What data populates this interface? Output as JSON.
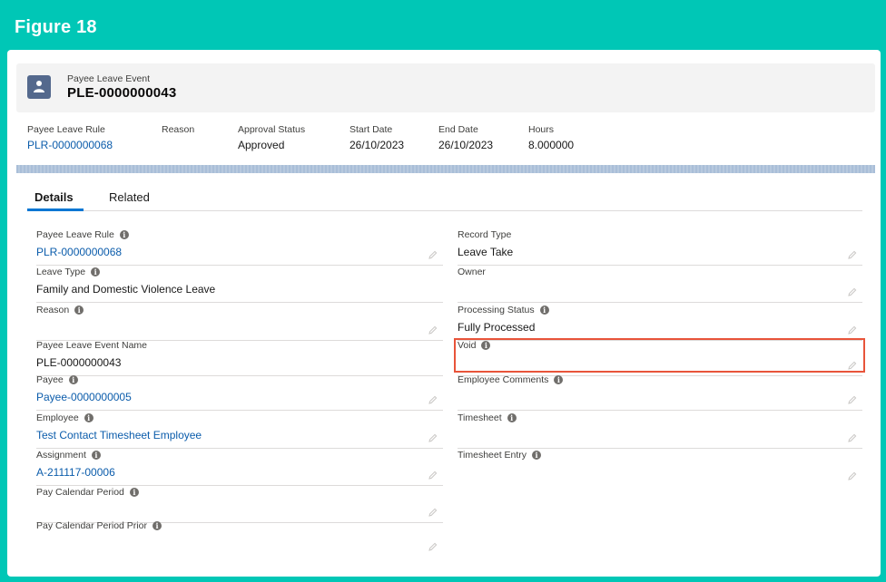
{
  "figure_title": "Figure 18",
  "record": {
    "object_type": "Payee Leave Event",
    "name": "PLE-0000000043"
  },
  "highlights": [
    {
      "label": "Payee Leave Rule",
      "value": "PLR-0000000068",
      "link": true
    },
    {
      "label": "Reason",
      "value": "",
      "link": false
    },
    {
      "label": "Approval Status",
      "value": "Approved",
      "link": false
    },
    {
      "label": "Start Date",
      "value": "26/10/2023",
      "link": false
    },
    {
      "label": "End Date",
      "value": "26/10/2023",
      "link": false
    },
    {
      "label": "Hours",
      "value": "8.000000",
      "link": false
    }
  ],
  "tabs": [
    {
      "label": "Details",
      "active": true
    },
    {
      "label": "Related",
      "active": false
    }
  ],
  "left_fields": [
    {
      "label": "Payee Leave Rule",
      "value": "PLR-0000000068",
      "link": true,
      "info": true,
      "editable": true
    },
    {
      "label": "Leave Type",
      "value": "Family and Domestic Violence Leave",
      "link": false,
      "info": true,
      "editable": false
    },
    {
      "label": "Reason",
      "value": "",
      "link": false,
      "info": true,
      "editable": true
    },
    {
      "label": "Payee Leave Event Name",
      "value": "PLE-0000000043",
      "link": false,
      "info": false,
      "editable": false
    },
    {
      "label": "Payee",
      "value": "Payee-0000000005",
      "link": true,
      "info": true,
      "editable": true
    },
    {
      "label": "Employee",
      "value": "Test Contact Timesheet Employee",
      "link": true,
      "info": true,
      "editable": true
    },
    {
      "label": "Assignment",
      "value": "A-211117-00006",
      "link": true,
      "info": true,
      "editable": true
    },
    {
      "label": "Pay Calendar Period",
      "value": "",
      "link": false,
      "info": true,
      "editable": true
    },
    {
      "label": "Pay Calendar Period Prior",
      "value": "",
      "link": false,
      "info": true,
      "editable": true
    }
  ],
  "right_fields": [
    {
      "label": "Record Type",
      "value": "Leave Take",
      "link": false,
      "info": false,
      "editable": true
    },
    {
      "label": "Owner",
      "value": "",
      "link": false,
      "info": false,
      "editable": true
    },
    {
      "label": "Processing Status",
      "value": "Fully Processed",
      "link": false,
      "info": true,
      "editable": true
    },
    {
      "label": "Void",
      "value": "",
      "link": false,
      "info": true,
      "editable": true
    },
    {
      "label": "Employee Comments",
      "value": "",
      "link": false,
      "info": true,
      "editable": true
    },
    {
      "label": "Timesheet",
      "value": "",
      "link": false,
      "info": true,
      "editable": true
    },
    {
      "label": "Timesheet Entry",
      "value": "",
      "link": false,
      "info": true,
      "editable": true
    }
  ],
  "colors": {
    "frame": "#00c7b6",
    "link": "#0b5cab",
    "highlight_box": "#e8543a",
    "tab_active": "#0176d3"
  },
  "icons": {
    "record_icon": "payee-leave-event-icon",
    "info": "info-icon",
    "edit": "pencil-icon"
  }
}
